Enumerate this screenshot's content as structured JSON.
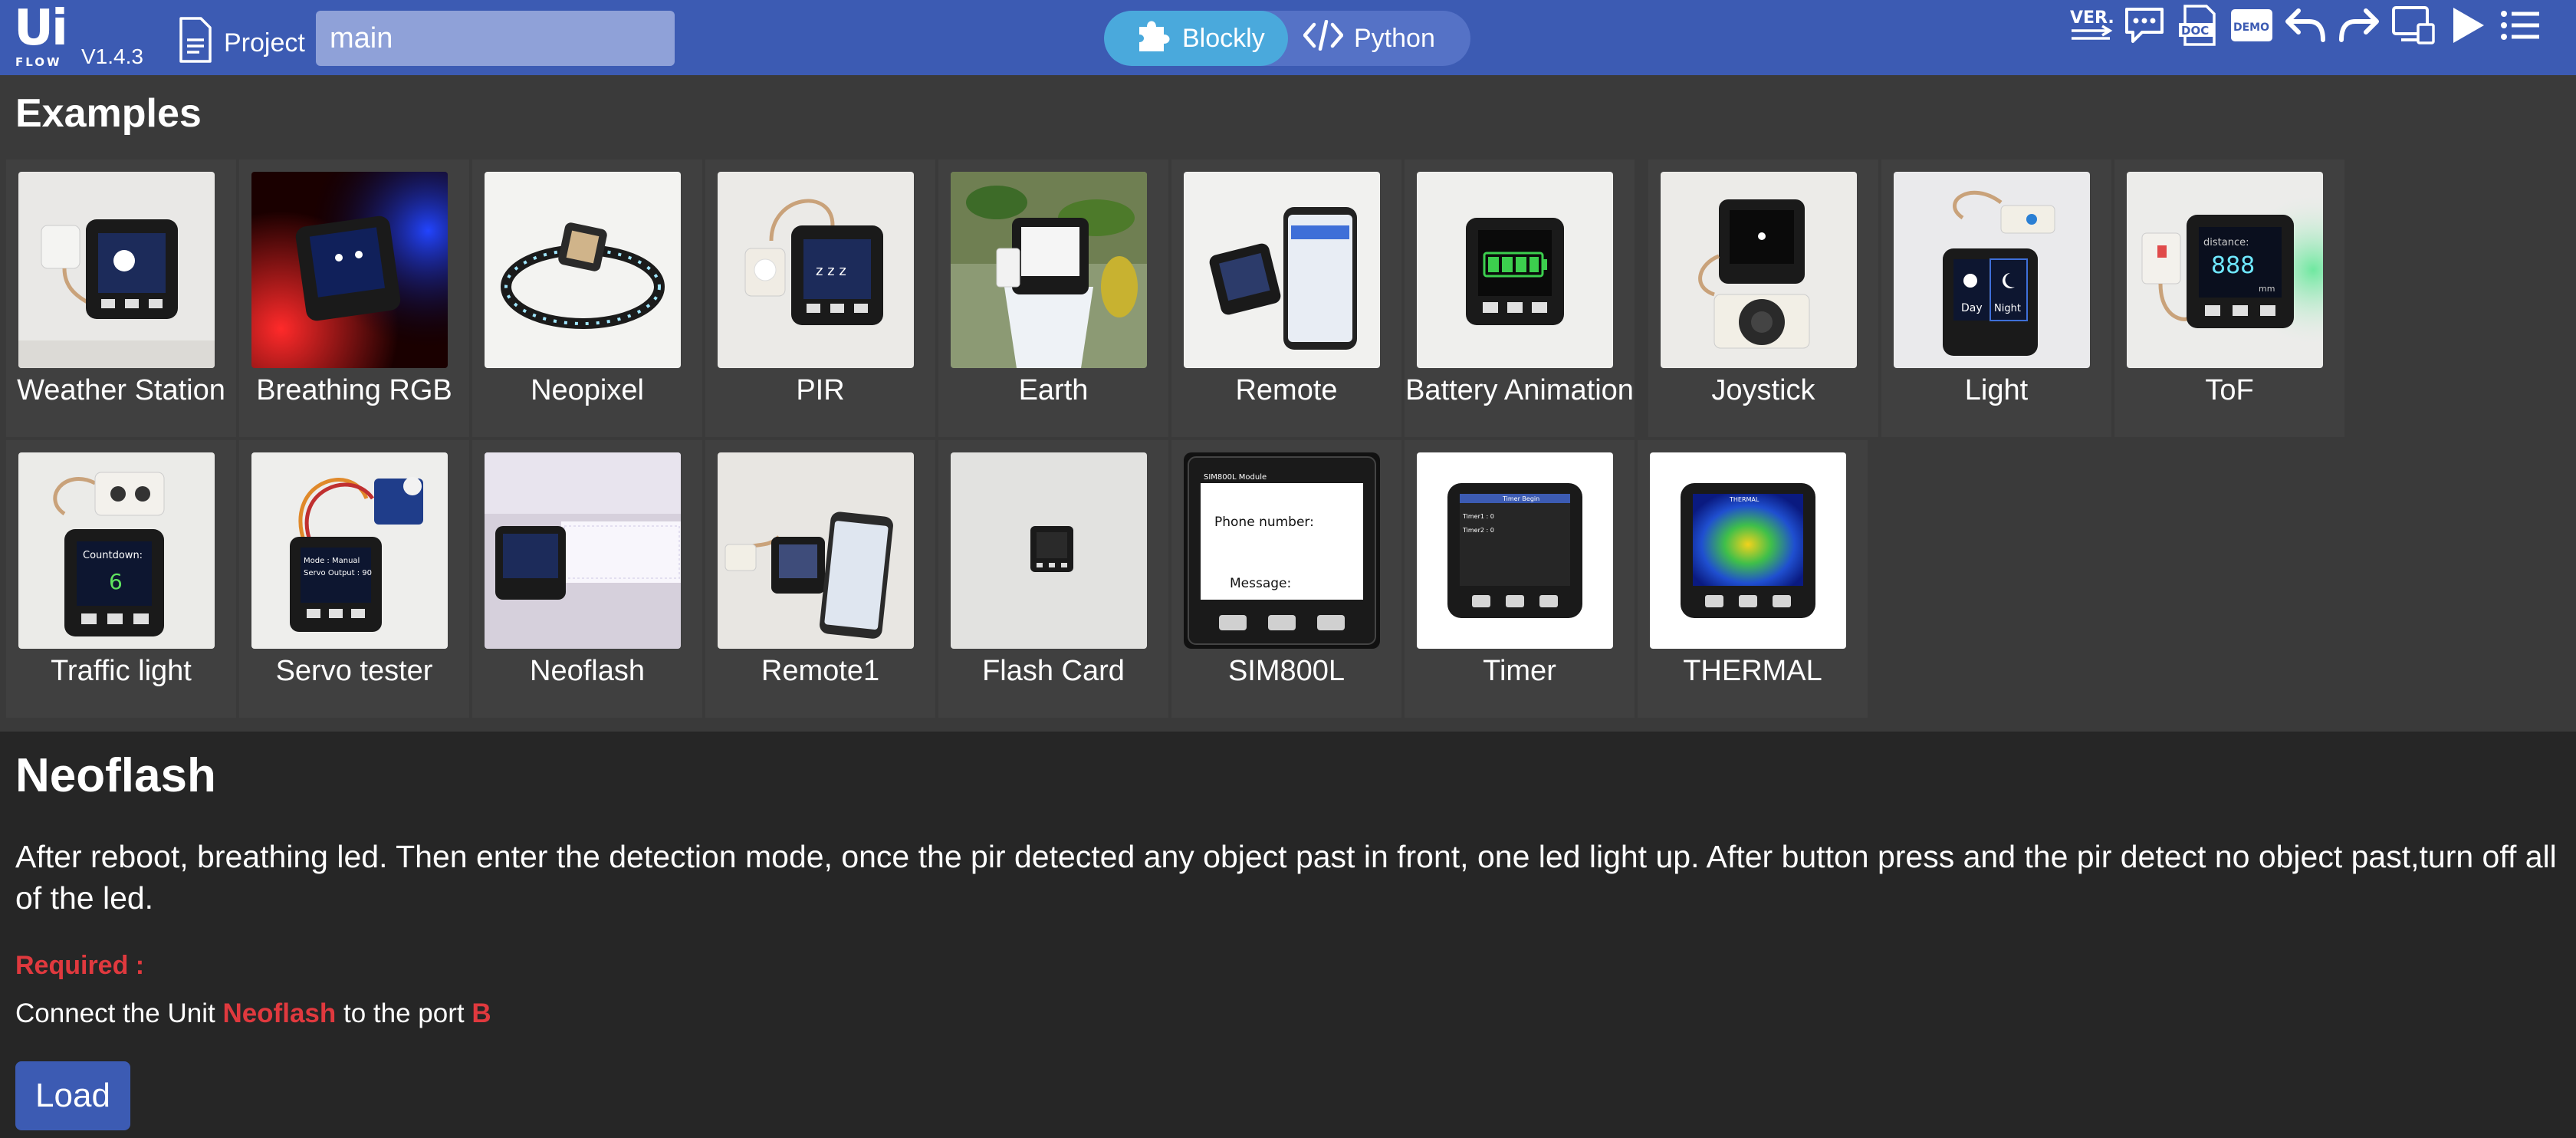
{
  "app": {
    "logo_text": "Ui",
    "logo_sub": "FLOW",
    "version": "V1.4.3"
  },
  "header": {
    "project_label": "Project",
    "file_name": "main",
    "modes": [
      {
        "label": "Blockly",
        "active": true
      },
      {
        "label": "Python",
        "active": false
      }
    ]
  },
  "toolbar": {
    "icons": [
      "version-icon",
      "comment-icon",
      "doc-icon",
      "demo-icon",
      "undo-icon",
      "redo-icon",
      "device-icon",
      "run-icon",
      "menu-icon"
    ],
    "ver_text": "VER.",
    "doc_text": "DOC",
    "demo_text": "DEMO"
  },
  "examples": {
    "title": "Examples",
    "items": [
      {
        "label": "Weather Station"
      },
      {
        "label": "Breathing RGB"
      },
      {
        "label": "Neopixel"
      },
      {
        "label": "PIR"
      },
      {
        "label": "Earth"
      },
      {
        "label": "Remote"
      },
      {
        "label": "Battery Animation"
      },
      {
        "label": "Joystick"
      },
      {
        "label": "Light"
      },
      {
        "label": "ToF"
      },
      {
        "label": "Traffic light"
      },
      {
        "label": "Servo tester"
      },
      {
        "label": "Neoflash"
      },
      {
        "label": "Remote1"
      },
      {
        "label": "Flash Card"
      },
      {
        "label": "SIM800L"
      },
      {
        "label": "Timer"
      },
      {
        "label": "THERMAL"
      }
    ]
  },
  "screen_text": {
    "light_day": "Day",
    "light_night": "Night",
    "tof_value": "888",
    "tof_distance": "distance:",
    "tof_unit": "mm",
    "countdown_title": "Countdown:",
    "countdown_value": "6",
    "servo_mode": "Mode : Manual",
    "servo_output": "Servo Output : 90",
    "sim_title": "SIM800L Module",
    "sim_phone": "Phone number:",
    "sim_message": "Message:",
    "timer_title": "Timer Begin",
    "timer1": "Timer1 : 0",
    "timer2": "Timer2 : 0",
    "thermal_title": "THERMAL",
    "pir_zzz": "z z z"
  },
  "detail": {
    "title": "Neoflash",
    "description": "After reboot,  breathing led. Then enter the detection mode, once the pir detected any object past in front, one led light up. After button press and the pir detect no object past,turn off all of the led.",
    "required_label": "Required :",
    "req_prefix": "Connect the Unit ",
    "req_unit": "Neoflash",
    "req_mid": " to the port ",
    "req_port": "B",
    "load_label": "Load"
  },
  "colors": {
    "header_bg": "#3c5bb3",
    "blockly_active": "#4aa9dc",
    "accent_red": "#e0393e",
    "panel_bg": "#262626",
    "grid_bg": "#3a3a3a"
  }
}
